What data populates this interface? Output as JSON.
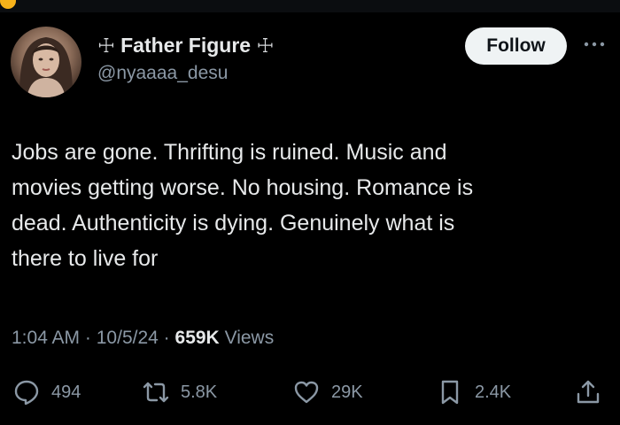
{
  "user": {
    "display_name": "Father Figure",
    "cross_left": "☩",
    "cross_right": "☩",
    "handle": "@nyaaaa_desu"
  },
  "follow_button": {
    "label": "Follow"
  },
  "more_button": {
    "icon": "more-horizontal-icon"
  },
  "tweet": {
    "lines": [
      "Jobs are gone. Thrifting is ruined. Music and",
      "movies getting worse. No housing. Romance is",
      "dead. Authenticity is dying. Genuinely what is",
      "there to live for"
    ]
  },
  "meta": {
    "time": "1:04 AM",
    "date": "10/5/24",
    "views_count": "659K",
    "views_label": "Views",
    "separator": "·"
  },
  "actions": {
    "replies": {
      "icon": "reply-icon",
      "count": "494"
    },
    "reposts": {
      "icon": "repost-icon",
      "count": "5.8K"
    },
    "likes": {
      "icon": "heart-icon",
      "count": "29K"
    },
    "bookmarks": {
      "icon": "bookmark-icon",
      "count": "2.4K"
    },
    "share": {
      "icon": "share-icon"
    }
  },
  "colors": {
    "background": "#000000",
    "text_primary": "#e7e9ea",
    "text_secondary": "#8b98a5",
    "follow_bg": "#eff3f4",
    "follow_text": "#0f1419"
  }
}
